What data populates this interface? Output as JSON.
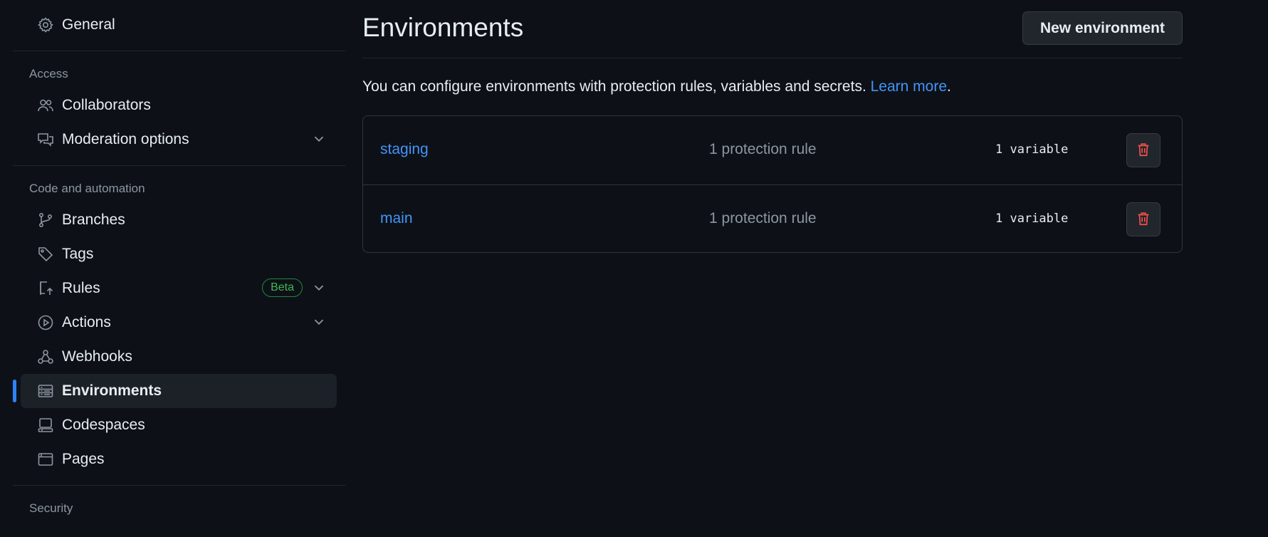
{
  "sidebar": {
    "general": "General",
    "access_title": "Access",
    "collaborators": "Collaborators",
    "moderation": "Moderation options",
    "code_title": "Code and automation",
    "branches": "Branches",
    "tags": "Tags",
    "rules": "Rules",
    "rules_badge": "Beta",
    "actions": "Actions",
    "webhooks": "Webhooks",
    "environments": "Environments",
    "codespaces": "Codespaces",
    "pages": "Pages",
    "security_title": "Security"
  },
  "main": {
    "title": "Environments",
    "new_button": "New environment",
    "description": "You can configure environments with protection rules, variables and secrets.",
    "learn_more": "Learn more",
    "period": ".",
    "environments": [
      {
        "name": "staging",
        "rules": "1 protection rule",
        "variables": "1 variable"
      },
      {
        "name": "main",
        "rules": "1 protection rule",
        "variables": "1 variable"
      }
    ]
  },
  "colors": {
    "background": "#0d1117",
    "accent_link": "#4493f8",
    "active_indicator": "#2f81f7",
    "danger": "#f85149",
    "badge_green": "#3fb950"
  }
}
